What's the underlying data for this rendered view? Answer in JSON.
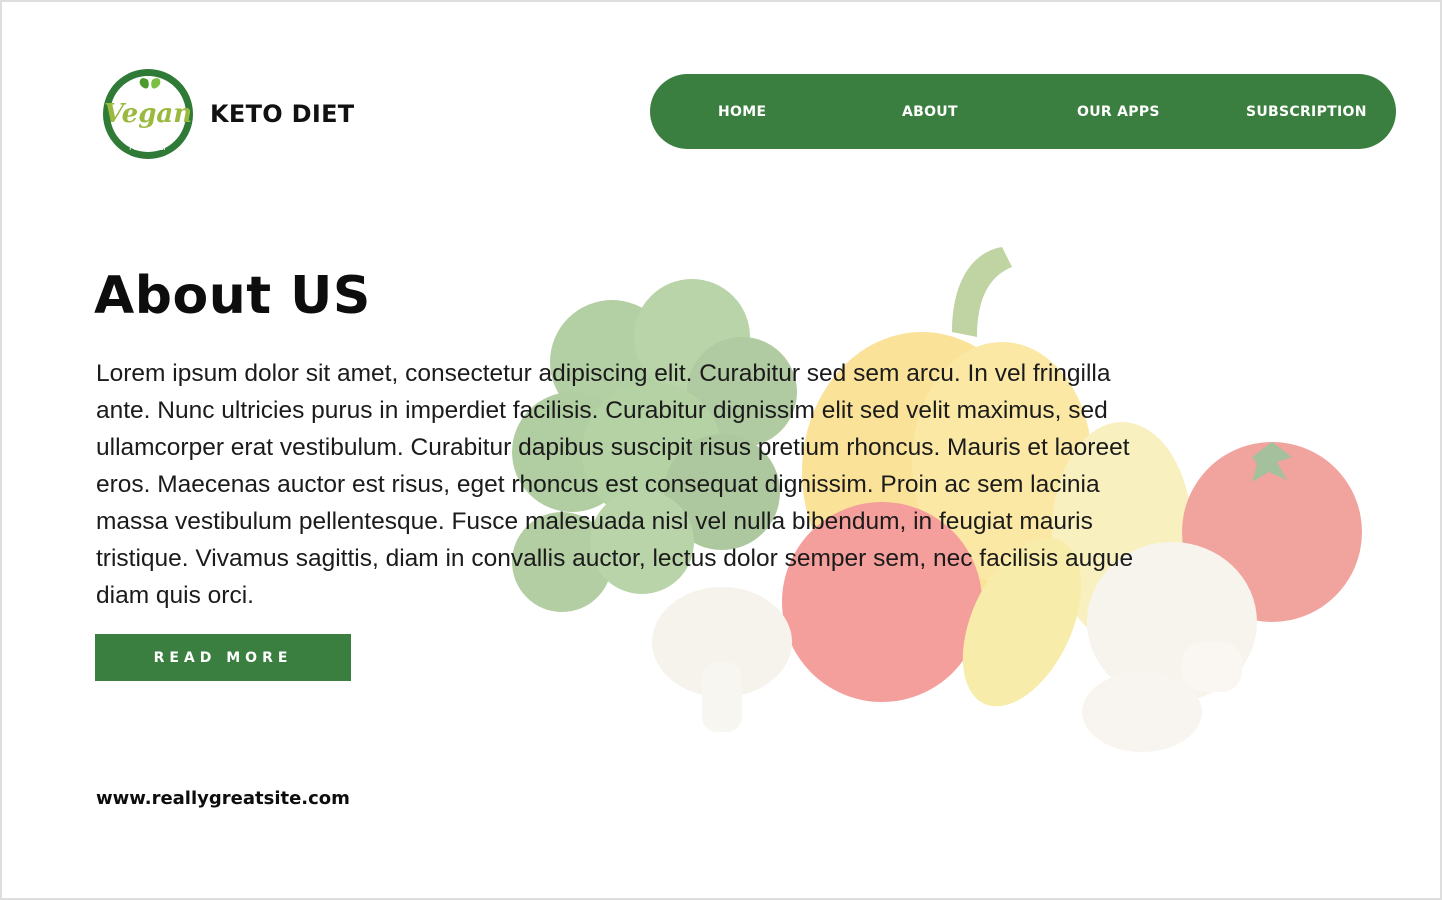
{
  "brand": {
    "logo_text": "Vegan",
    "logo_subtext": "FRIENDLY",
    "name": "KETO DIET"
  },
  "nav": {
    "items": [
      {
        "label": "HOME"
      },
      {
        "label": "ABOUT"
      },
      {
        "label": "OUR APPS"
      },
      {
        "label": "SUBSCRIPTION"
      }
    ]
  },
  "main": {
    "title": "About US",
    "body": "Lorem ipsum dolor sit amet, consectetur adipiscing elit. Curabitur sed sem arcu. In vel fringilla ante. Nunc ultricies purus in imperdiet facilisis. Curabitur dignissim elit sed velit maximus, sed ullamcorper erat vestibulum. Curabitur dapibus suscipit risus pretium rhoncus. Mauris et laoreet eros. Maecenas auctor est risus, eget rhoncus est consequat dignissim. Proin ac sem lacinia massa vestibulum pellentesque. Fusce malesuada nisl vel nulla bibendum, in feugiat mauris tristique. Vivamus sagittis, diam in convallis auctor, lectus dolor semper sem, nec facilisis augue diam quis orci.",
    "button_label": "READ MORE"
  },
  "footer": {
    "url": "www.reallygreatsite.com"
  },
  "colors": {
    "accent": "#3a7f3f",
    "text": "#111111",
    "background": "#ffffff"
  },
  "icons": {
    "logo": "vegan-friendly-badge",
    "background_image": "vegetables-photo"
  }
}
